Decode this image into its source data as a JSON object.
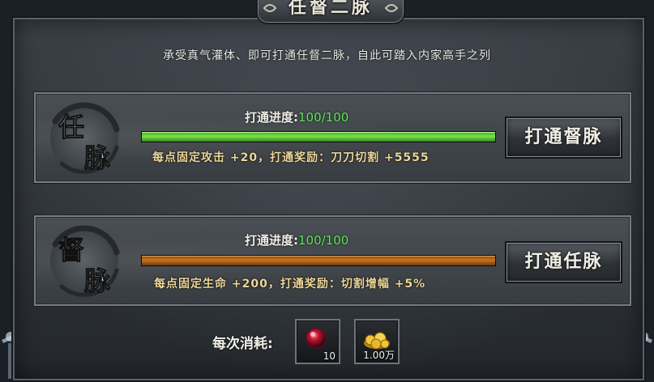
{
  "window": {
    "title": "任督二脉",
    "description": "承受真气灌体、即可打通任督二脉，自此可踏入内家高手之列"
  },
  "meridians": [
    {
      "seal_char_top": "任",
      "seal_char_bottom": "脉",
      "progress_label": "打通进度:",
      "progress_value": "100/100",
      "progress_fraction": 1.0,
      "bar_color": "green",
      "bonus_text": "每点固定攻击 +20，打通奖励：刀刀切割 +5555",
      "button_label": "打通督脉"
    },
    {
      "seal_char_top": "督",
      "seal_char_bottom": "脉",
      "progress_label": "打通进度:",
      "progress_value": "100/100",
      "progress_fraction": 1.0,
      "bar_color": "orange",
      "bonus_text": "每点固定生命 +200，打通奖励：切割增幅 +5%",
      "button_label": "打通任脉"
    }
  ],
  "cost": {
    "label": "每次消耗:",
    "items": [
      {
        "icon": "red-orb-icon",
        "amount": "10"
      },
      {
        "icon": "gold-ingot-icon",
        "amount": "1.00万"
      }
    ]
  },
  "colors": {
    "progress_value": "#5fe85a",
    "bonus_text": "#efd99a",
    "green_bar": "#7fe04a",
    "orange_bar": "#c4761f"
  }
}
